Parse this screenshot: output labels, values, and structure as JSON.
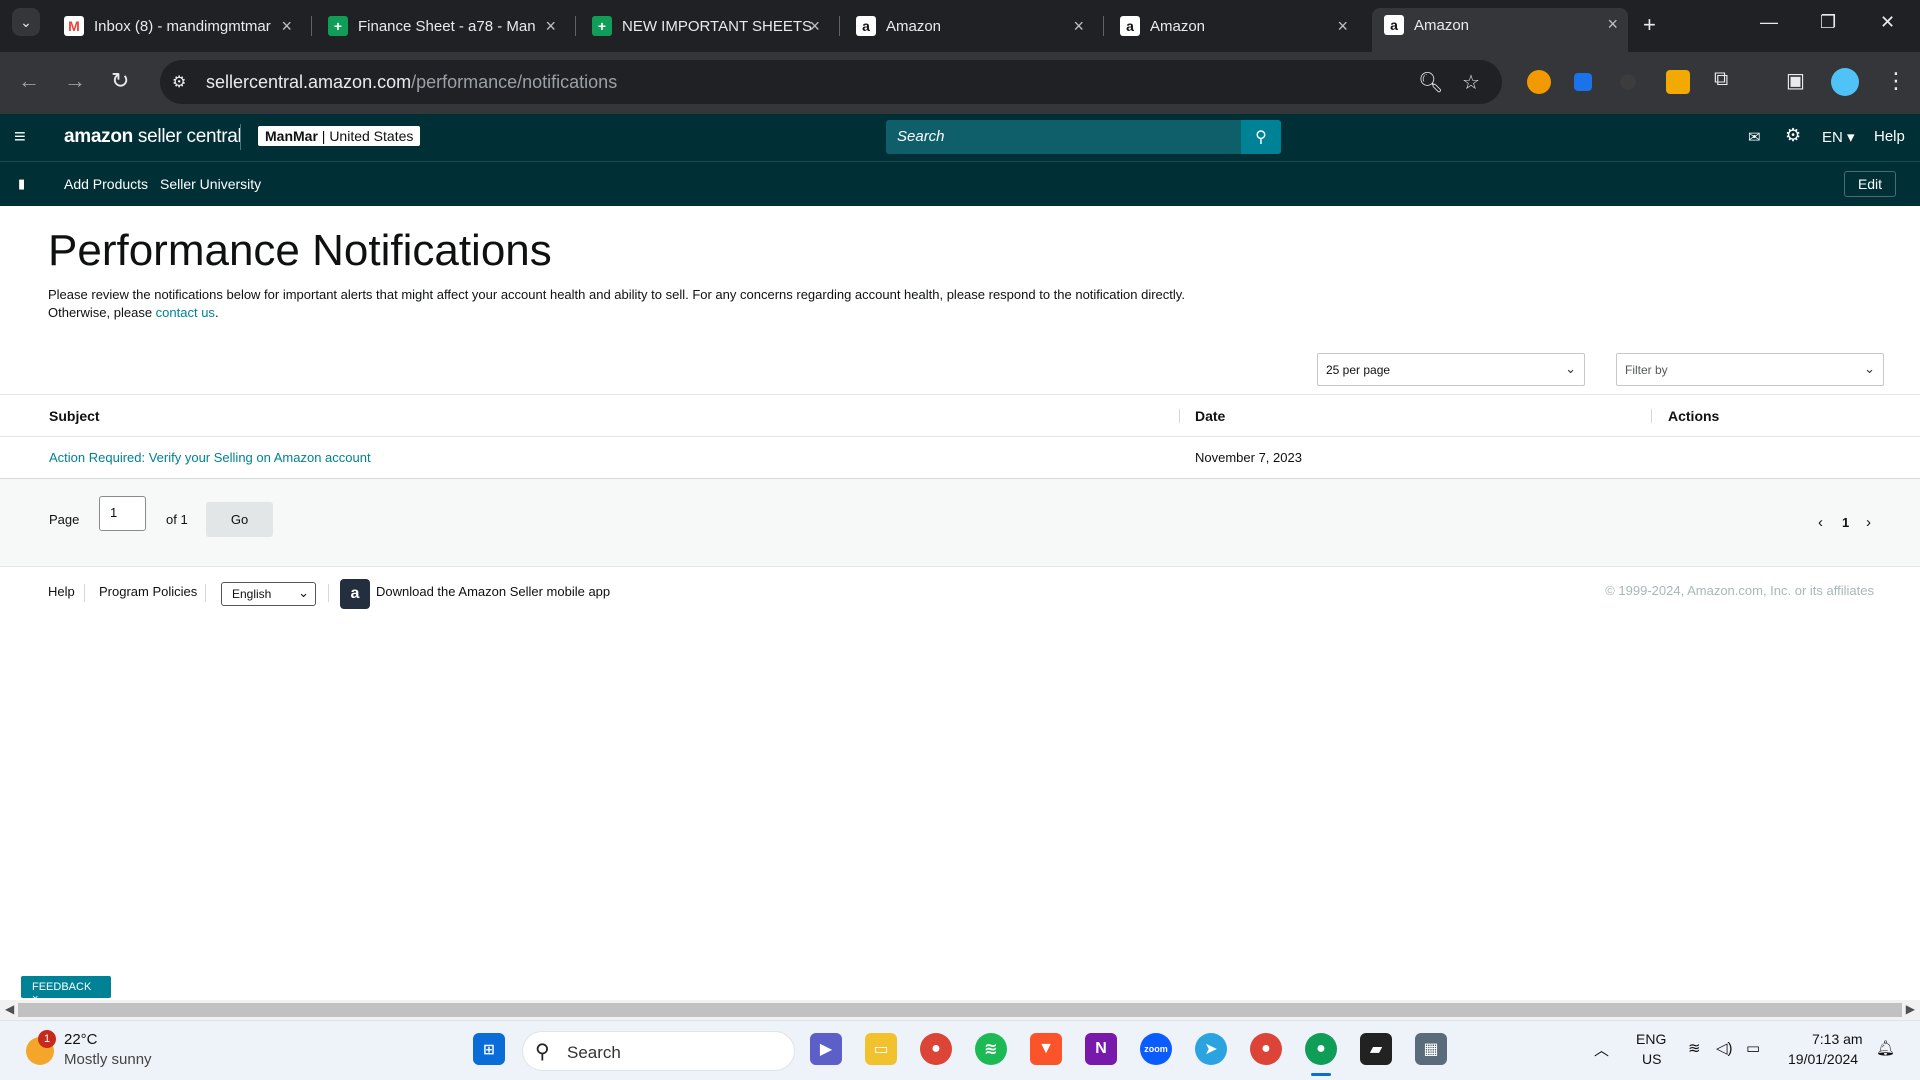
{
  "browser": {
    "tabs": [
      {
        "title": "Inbox (8) - mandimgmtmar",
        "favicon": "gmail-icon",
        "color": "#ea4335",
        "glyph": "M"
      },
      {
        "title": "Finance Sheet - a78 - Man",
        "favicon": "sheets-icon",
        "color": "#0f9d58",
        "glyph": "+"
      },
      {
        "title": "NEW IMPORTANT SHEETS",
        "favicon": "sheets-icon",
        "color": "#0f9d58",
        "glyph": "+"
      },
      {
        "title": "Amazon",
        "favicon": "amazon-icon",
        "color": "#ffffff",
        "glyph": "a"
      },
      {
        "title": "Amazon",
        "favicon": "amazon-icon",
        "color": "#ffffff",
        "glyph": "a"
      },
      {
        "title": "Amazon",
        "favicon": "amazon-icon",
        "color": "#ffffff",
        "glyph": "a"
      }
    ],
    "url_host": "sellercentral.amazon.com",
    "url_path": "/performance/notifications"
  },
  "seller_central": {
    "logo_brand": "amazon",
    "logo_product": " seller central",
    "store_name": "ManMar",
    "store_region": " | United States",
    "search_placeholder": "Search",
    "lang": "EN",
    "help": "Help",
    "nav": {
      "add_products": "Add Products",
      "seller_university": "Seller University",
      "edit": "Edit"
    }
  },
  "page": {
    "title": "Performance Notifications",
    "description": "Please review the notifications below for important alerts that might affect your account health and ability to sell. For any concerns regarding account health, please respond to the notification directly. Otherwise, please ",
    "contact_link": "contact us",
    "description_end": ".",
    "per_page": "25 per page",
    "filter_placeholder": "Filter by",
    "table": {
      "headers": {
        "subject": "Subject",
        "date": "Date",
        "actions": "Actions"
      },
      "rows": [
        {
          "subject": "Action Required: Verify your Selling on Amazon account",
          "date": "November 7, 2023",
          "actions": ""
        }
      ]
    },
    "pager": {
      "page_label": "Page",
      "page_value": "1",
      "of_label": "of 1",
      "go": "Go",
      "current": "1"
    }
  },
  "footer": {
    "help": "Help",
    "program_policies": "Program Policies",
    "language": "English",
    "app_text": "Download the Amazon Seller mobile app",
    "copyright": "© 1999-2024, Amazon.com, Inc. or its affiliates"
  },
  "feedback": "FEEDBACK ×",
  "taskbar": {
    "weather_temp": "22°C",
    "weather_desc": "Mostly sunny",
    "weather_badge": "1",
    "search": "Search",
    "lang_line1": "ENG",
    "lang_line2": "US",
    "time": "7:13 am",
    "date": "19/01/2024"
  },
  "colors": {
    "seller_header": "#002f36",
    "accent_teal": "#008296",
    "link": "#008296"
  }
}
